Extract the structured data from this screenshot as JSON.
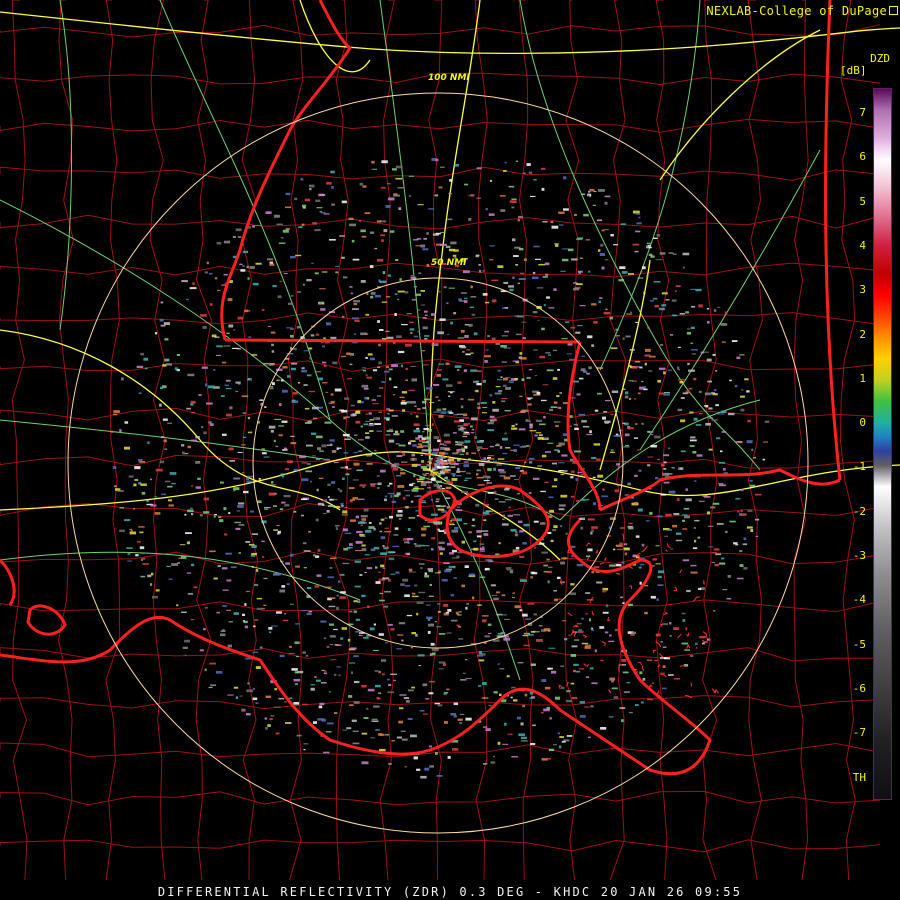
{
  "credit": "NEXLAB-College of DuPage",
  "product_title": "DIFFERENTIAL REFLECTIVITY (ZDR) 0.3 DEG - KHDC 20 JAN 26 09:55",
  "legend": {
    "title": "DZD",
    "unit": "[dB]",
    "ticks": [
      "7",
      "6",
      "5",
      "4",
      "3",
      "2",
      "1",
      "0",
      "-1",
      "-2",
      "-3",
      "-4",
      "-5",
      "-6",
      "-7",
      "TH"
    ]
  },
  "range_rings": [
    {
      "label": "50 NMI",
      "range_nmi": 50
    },
    {
      "label": "100 NMI",
      "range_nmi": 100
    }
  ],
  "colors": {
    "state_border": "#ff2020",
    "county_border": "#a01010",
    "highway": "#ffff40",
    "road": "#80e080",
    "ring": "#ffe0a0",
    "text": "#f7f700"
  }
}
